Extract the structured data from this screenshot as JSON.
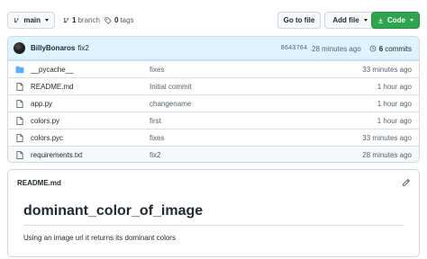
{
  "toolbar": {
    "branch_label": "main",
    "branches_count": "1",
    "branches_label": "branch",
    "tags_count": "0",
    "tags_label": "tags",
    "go_to_file": "Go to file",
    "add_file": "Add file",
    "code": "Code"
  },
  "commit": {
    "author": "BillyBonaros",
    "message": "fix2",
    "sha": "8643764",
    "time": "28 minutes ago",
    "count": "6",
    "count_label": "commits"
  },
  "files": [
    {
      "type": "folder",
      "name": "__pycache__",
      "commit": "fixes",
      "time": "33 minutes ago"
    },
    {
      "type": "file",
      "name": "README.md",
      "commit": "Initial commit",
      "time": "1 hour ago"
    },
    {
      "type": "file",
      "name": "app.py",
      "commit": "changename",
      "time": "1 hour ago"
    },
    {
      "type": "file",
      "name": "colors.py",
      "commit": "first",
      "time": "1 hour ago"
    },
    {
      "type": "file",
      "name": "colors.pyc",
      "commit": "fixes",
      "time": "33 minutes ago"
    },
    {
      "type": "file",
      "name": "requirements.txt",
      "commit": "fix2",
      "time": "28 minutes ago"
    }
  ],
  "readme": {
    "filename": "README.md",
    "heading": "dominant_color_of_image",
    "body": "Using an image url it returns its dominant colors"
  },
  "colors": {
    "accent_green": "#2da44e",
    "commit_bar": "#ddf4ff",
    "folder_blue": "#54aeff"
  }
}
